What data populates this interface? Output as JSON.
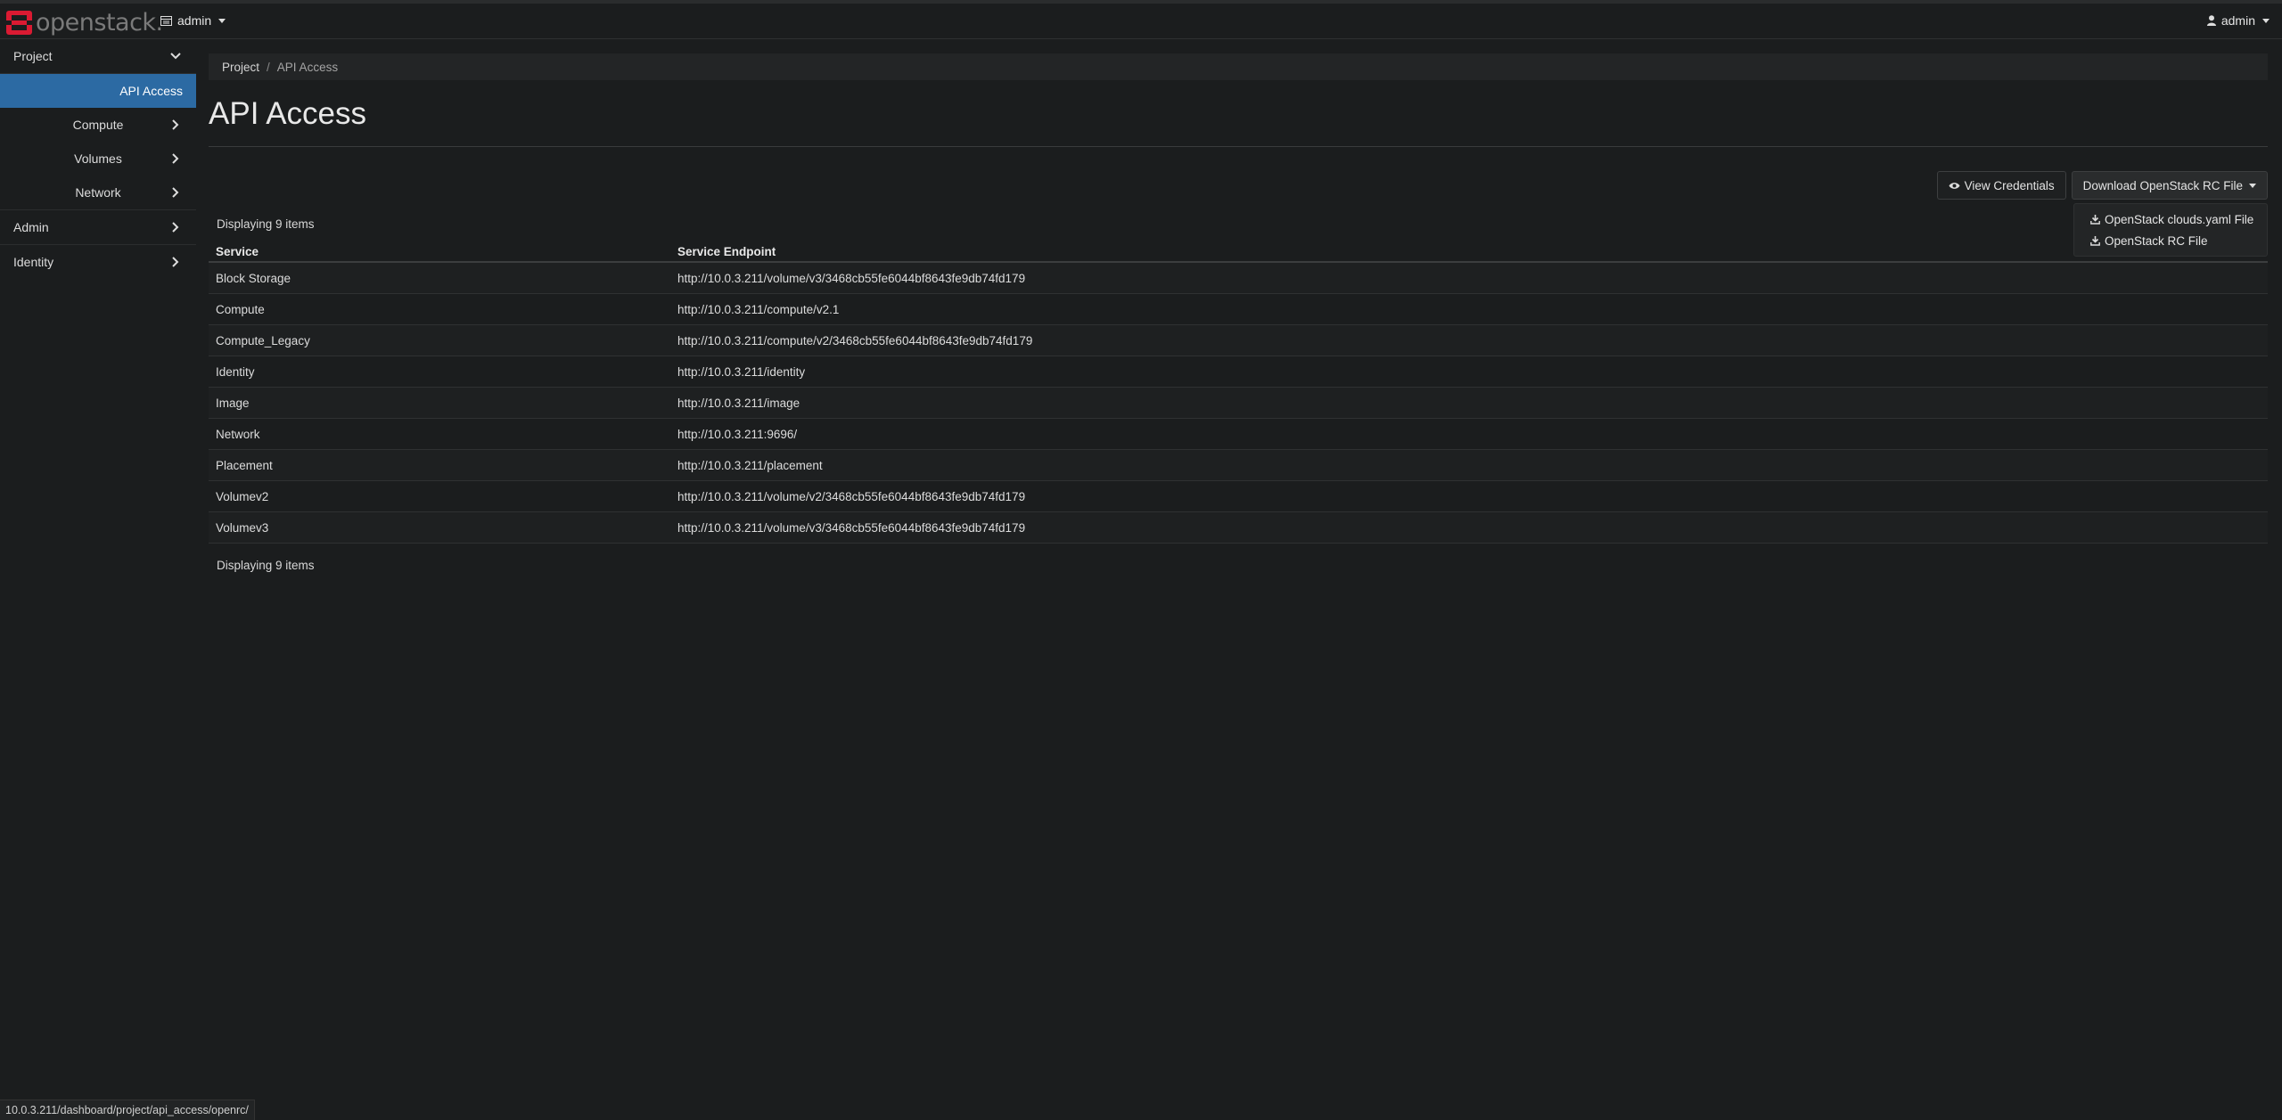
{
  "header": {
    "logo_text": "openstack.",
    "project_switcher": "admin",
    "user_menu": "admin"
  },
  "sidebar": {
    "items": [
      {
        "label": "Project"
      },
      {
        "label": "API Access"
      },
      {
        "label": "Compute"
      },
      {
        "label": "Volumes"
      },
      {
        "label": "Network"
      },
      {
        "label": "Admin"
      },
      {
        "label": "Identity"
      }
    ]
  },
  "breadcrumb": {
    "root": "Project",
    "separator": "/",
    "current": "API Access"
  },
  "page_title": "API Access",
  "actions": {
    "view_credentials": "View Credentials",
    "download_rc": "Download OpenStack RC File",
    "dropdown": [
      "OpenStack clouds.yaml File",
      "OpenStack RC File"
    ]
  },
  "table": {
    "count_text": "Displaying 9 items",
    "headers": [
      "Service",
      "Service Endpoint"
    ],
    "rows": [
      [
        "Block Storage",
        "http://10.0.3.211/volume/v3/3468cb55fe6044bf8643fe9db74fd179"
      ],
      [
        "Compute",
        "http://10.0.3.211/compute/v2.1"
      ],
      [
        "Compute_Legacy",
        "http://10.0.3.211/compute/v2/3468cb55fe6044bf8643fe9db74fd179"
      ],
      [
        "Identity",
        "http://10.0.3.211/identity"
      ],
      [
        "Image",
        "http://10.0.3.211/image"
      ],
      [
        "Network",
        "http://10.0.3.211:9696/"
      ],
      [
        "Placement",
        "http://10.0.3.211/placement"
      ],
      [
        "Volumev2",
        "http://10.0.3.211/volume/v2/3468cb55fe6044bf8643fe9db74fd179"
      ],
      [
        "Volumev3",
        "http://10.0.3.211/volume/v3/3468cb55fe6044bf8643fe9db74fd179"
      ]
    ]
  },
  "status_url": "10.0.3.211/dashboard/project/api_access/openrc/",
  "colors": {
    "active_nav": "#2c6aa3",
    "logo_red": "#da1a32",
    "background": "#1b1d1e"
  }
}
